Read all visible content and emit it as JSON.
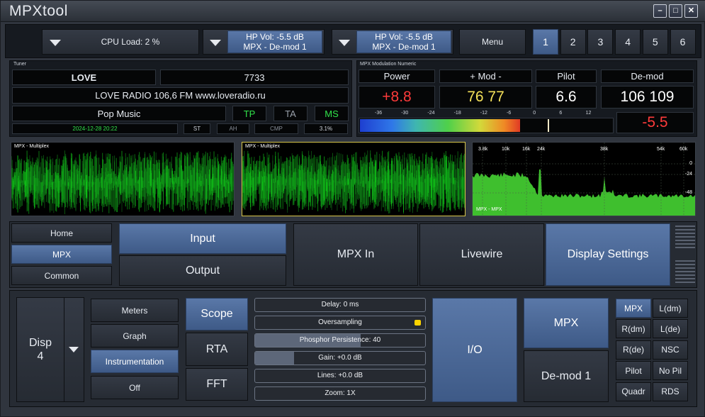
{
  "app": {
    "title": "MPXtool"
  },
  "window_controls": {
    "minimize": "–",
    "maximize": "□",
    "close": "✕"
  },
  "topbar": {
    "cpu_load": "CPU Load: 2 %",
    "hp1_line1": "HP Vol: -5.5 dB",
    "hp1_line2": "MPX - De-mod 1",
    "hp2_line1": "HP Vol: -5.5 dB",
    "hp2_line2": "MPX - De-mod 1",
    "menu": "Menu",
    "presets": [
      "1",
      "2",
      "3",
      "4",
      "5",
      "6"
    ],
    "selected_preset": "1"
  },
  "tuner": {
    "label": "Tuner",
    "station": "LOVE",
    "pi": "7733",
    "radiotext": "LOVE RADIO 106,6 FM www.loveradio.ru",
    "pty": "Pop Music",
    "flags": {
      "tp": "TP",
      "ta": "TA",
      "ms": "MS"
    },
    "datetime": "2024-12-28 20:22",
    "st": "ST",
    "ah": "AH",
    "cmp": "CMP",
    "pct": "3.1%"
  },
  "mpx_numeric": {
    "label": "MPX Modulation Numeric",
    "power_label": "Power",
    "mod_label": "+ Mod -",
    "pilot_label": "Pilot",
    "demod_label": "De-mod",
    "power": "+8.8",
    "mod": "76 77",
    "pilot": "6.6",
    "demod": "106 109",
    "demod_vol": "-5.5",
    "scale": [
      "-36",
      "-30",
      "-24",
      "-18",
      "-12",
      "-6",
      "0",
      "6",
      "12"
    ],
    "meter_level": 0.63,
    "colors": {
      "power": "#ff3b3b",
      "mod": "#f5e15a",
      "demod_vol": "#ff3b3b"
    }
  },
  "scopes": {
    "panel1_label": "MPX - Multiplex",
    "panel2_label": "MPX - Multiplex",
    "panel3_label": "MPX - MPX",
    "fft_x_labels": [
      "3.8k",
      "10k",
      "16k",
      "24k",
      "38k",
      "54k",
      "60k"
    ],
    "fft_y_labels": [
      "0",
      "-24",
      "-48"
    ]
  },
  "nav": {
    "home": "Home",
    "mpx": "MPX",
    "common": "Common",
    "input": "Input",
    "output": "Output",
    "mpx_in": "MPX In",
    "livewire": "Livewire",
    "display_settings": "Display Settings"
  },
  "display": {
    "disp_label": "Disp",
    "disp_num": "4",
    "modes": [
      "Meters",
      "Graph",
      "Instrumentation",
      "Off"
    ],
    "selected_mode": "Instrumentation",
    "types": [
      "Scope",
      "RTA",
      "FFT"
    ],
    "selected_type": "Scope"
  },
  "sliders": [
    {
      "label": "Delay: 0 ms",
      "level": 0
    },
    {
      "label": "Oversampling",
      "level": 0
    },
    {
      "label": "Phosphor Persistence: 40",
      "level": 0.62
    },
    {
      "label": "Gain: +0.0 dB",
      "level": 0.23
    },
    {
      "label": "Lines: +0.0 dB",
      "level": 0
    },
    {
      "label": "Zoom: 1X",
      "level": 0
    }
  ],
  "io": {
    "io": "I/O",
    "mpx": "MPX",
    "demod": "De-mod 1"
  },
  "channels": [
    "MPX",
    "L(dm)",
    "R(dm)",
    "L(de)",
    "R(de)",
    "NSC",
    "Pilot",
    "No Pil",
    "Quadr",
    "RDS"
  ],
  "selected_channel": "MPX"
}
